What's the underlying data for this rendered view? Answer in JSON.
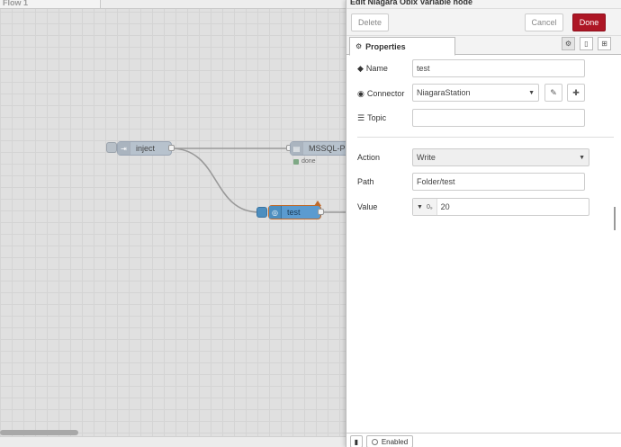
{
  "workspace": {
    "flow_tab": "Flow 1",
    "nodes": {
      "inject": {
        "label": "inject",
        "color": "#a6bbcf"
      },
      "mssql": {
        "label": "MSSQL-P",
        "status": "done",
        "color": "#a6bbcf"
      },
      "test": {
        "label": "test",
        "color": "#4d8ebf"
      }
    }
  },
  "editor": {
    "title": "Edit Niagara Obix Variable node",
    "toolbar": {
      "delete_label": "Delete",
      "cancel_label": "Cancel",
      "done_label": "Done"
    },
    "tabs": {
      "properties_label": "Properties"
    },
    "fields": {
      "name": {
        "label": "Name",
        "value": "test"
      },
      "connector": {
        "label": "Connector",
        "value": "NiagaraStation"
      },
      "topic": {
        "label": "Topic",
        "value": ""
      },
      "action": {
        "label": "Action",
        "value": "Write"
      },
      "path": {
        "label": "Path",
        "value": "Folder/test"
      },
      "value": {
        "label": "Value",
        "type_glyph": "0₉",
        "value": "20"
      }
    },
    "footer": {
      "enabled_label": "Enabled"
    }
  },
  "colors": {
    "done_button": "#ad1625",
    "accent_node": "#4d8ebf",
    "node_gray": "#a6bbcf"
  }
}
